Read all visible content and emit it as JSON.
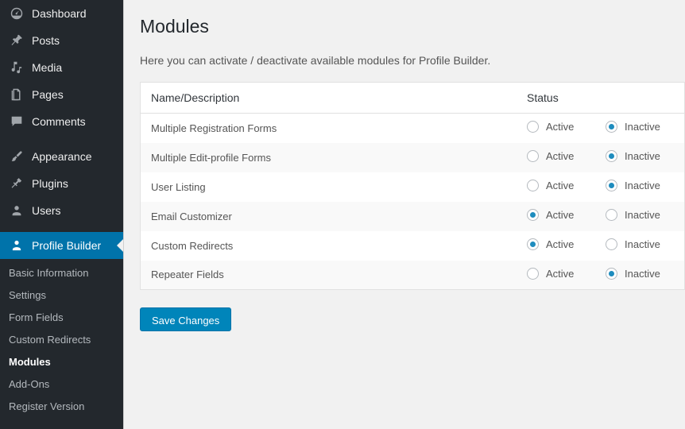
{
  "sidebar": {
    "top_items": [
      {
        "label": "Dashboard",
        "icon": "dashboard-icon",
        "current": false
      },
      {
        "label": "Posts",
        "icon": "pin-icon",
        "current": false
      },
      {
        "label": "Media",
        "icon": "media-icon",
        "current": false
      },
      {
        "label": "Pages",
        "icon": "pages-icon",
        "current": false
      },
      {
        "label": "Comments",
        "icon": "comment-icon",
        "current": false
      },
      {
        "label": "Appearance",
        "icon": "paintbrush-icon",
        "current": false
      },
      {
        "label": "Plugins",
        "icon": "plug-icon",
        "current": false
      },
      {
        "label": "Users",
        "icon": "user-icon",
        "current": false
      },
      {
        "label": "Profile Builder",
        "icon": "user-badge-icon",
        "current": true
      }
    ],
    "submenu": [
      {
        "label": "Basic Information",
        "current": false
      },
      {
        "label": "Settings",
        "current": false
      },
      {
        "label": "Form Fields",
        "current": false
      },
      {
        "label": "Custom Redirects",
        "current": false
      },
      {
        "label": "Modules",
        "current": true
      },
      {
        "label": "Add-Ons",
        "current": false
      },
      {
        "label": "Register Version",
        "current": false
      }
    ]
  },
  "main": {
    "title": "Modules",
    "description": "Here you can activate / deactivate available modules for Profile Builder.",
    "table": {
      "headers": {
        "name": "Name/Description",
        "status": "Status"
      },
      "status_labels": {
        "active": "Active",
        "inactive": "Inactive"
      },
      "rows": [
        {
          "name": "Multiple Registration Forms",
          "state": "inactive"
        },
        {
          "name": "Multiple Edit-profile Forms",
          "state": "inactive"
        },
        {
          "name": "User Listing",
          "state": "inactive"
        },
        {
          "name": "Email Customizer",
          "state": "active"
        },
        {
          "name": "Custom Redirects",
          "state": "active"
        },
        {
          "name": "Repeater Fields",
          "state": "inactive"
        }
      ]
    },
    "save_label": "Save Changes"
  },
  "colors": {
    "sidebar_bg": "#23282d",
    "accent_blue": "#0073aa",
    "button_blue": "#0085ba",
    "radio_blue": "#1e8cbe",
    "content_bg": "#f1f1f1"
  }
}
